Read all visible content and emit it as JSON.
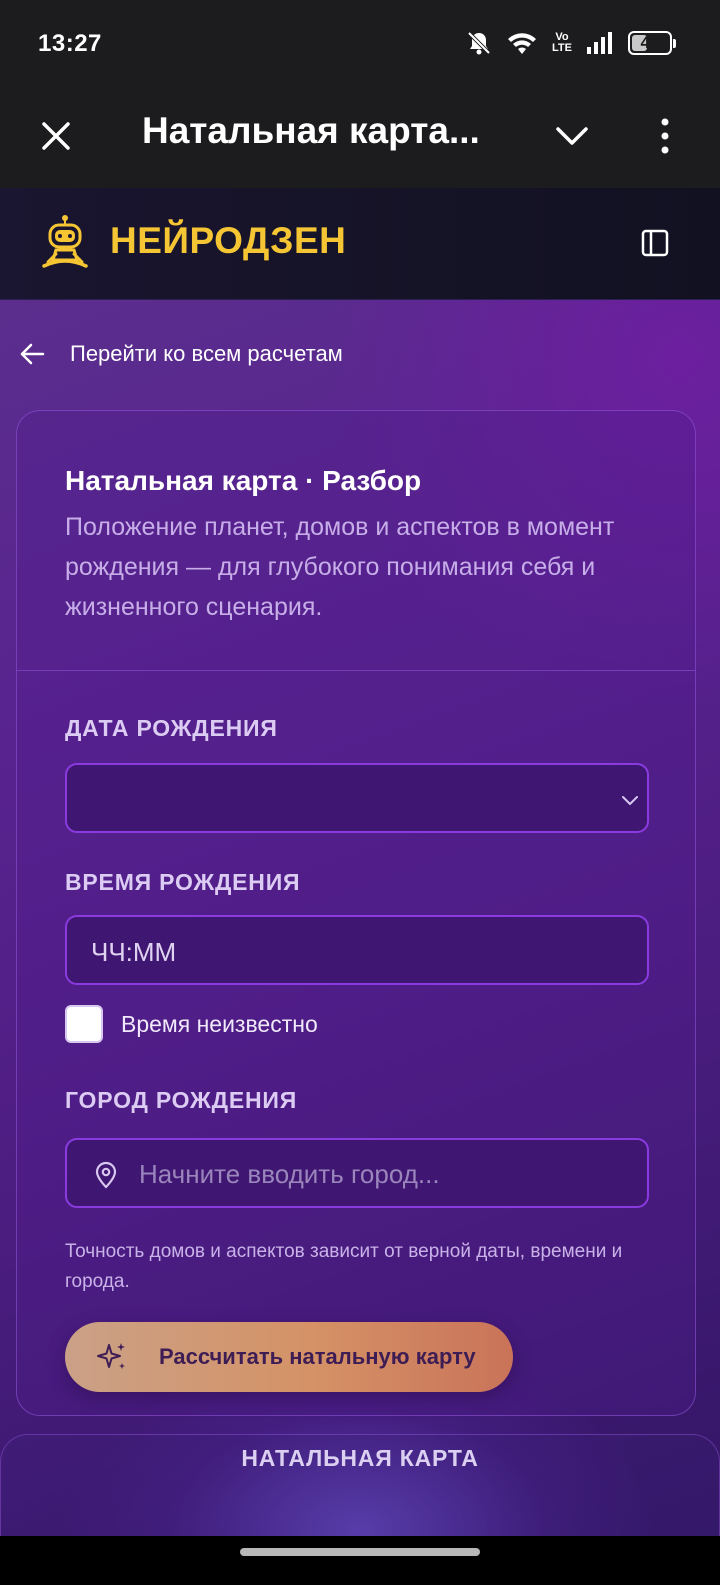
{
  "status_bar": {
    "time": "13:27",
    "battery_text": "48",
    "battery_level": 0.48,
    "volte_top": "Vo",
    "volte_bottom": "LTE",
    "icons": [
      "bell-muted-icon",
      "wifi-icon",
      "volte-icon",
      "signal-icon",
      "battery-icon"
    ]
  },
  "toolbar": {
    "title": "Натальная карта...",
    "icons": [
      "close-icon",
      "chevron-down-icon",
      "more-vert-icon"
    ]
  },
  "header": {
    "brand": "НЕЙРОДЗЕН",
    "brand_color": "#f5c533",
    "icons": [
      "robot-meditating-logo-icon",
      "sidebar-panel-icon"
    ]
  },
  "back_link": {
    "label": "Перейти ко всем расчетам",
    "icon": "arrow-left-icon"
  },
  "card": {
    "title": "Натальная карта · Разбор",
    "description": "Положение планет, домов и аспектов в момент рождения — для глубокого понимания себя и жизненного сценария.",
    "birth_date_label": "ДАТА РОЖДЕНИЯ",
    "birth_date_value": "",
    "birth_time_label": "ВРЕМЯ РОЖДЕНИЯ",
    "birth_time_value": "ЧЧ:ММ",
    "time_unknown_label": "Время неизвестно",
    "time_unknown_checked": false,
    "birth_city_label": "ГОРОД РОЖДЕНИЯ",
    "birth_city_placeholder": "Начните вводить город...",
    "note": "Точность домов и аспектов зависит от верной даты, времени и города.",
    "submit_label": "Рассчитать натальную карту"
  },
  "section": {
    "title": "НАТАЛЬНАЯ КАРТА"
  }
}
